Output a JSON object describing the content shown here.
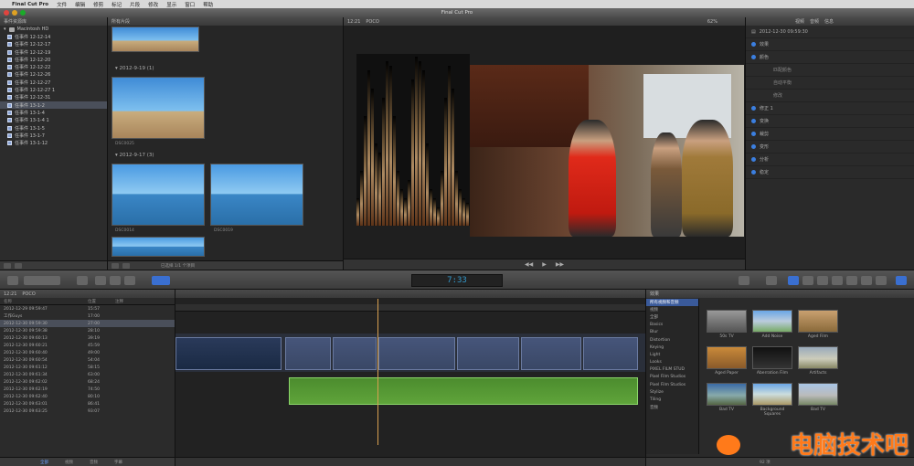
{
  "menubar": {
    "items": [
      "Final Cut Pro",
      "文件",
      "编辑",
      "修剪",
      "标记",
      "片段",
      "修改",
      "显示",
      "窗口",
      "帮助"
    ]
  },
  "window": {
    "title": "Final Cut Pro"
  },
  "library": {
    "header": "事件资源库",
    "disk": "Macintosh HD",
    "events": [
      "任事件 12-12-14",
      "任事件 12-12-17",
      "任事件 12-12-19",
      "任事件 12-12-20",
      "任事件 12-12-22",
      "任事件 12-12-26",
      "任事件 12-12-27",
      "任事件 12-12-27 1",
      "任事件 12-12-31",
      "任事件 13-1-2",
      "任事件 13-1-4",
      "任事件 13-1-4 1",
      "任事件 13-1-5",
      "任事件 13-1-7",
      "任事件 13-1-12"
    ],
    "selected_index": 9
  },
  "browser": {
    "header": "所有片段",
    "groups": [
      {
        "date": "2012-9-19",
        "count": "(1)"
      },
      {
        "date": "2012-9-17",
        "count": "(3)"
      }
    ],
    "clip_labels": [
      "DSC0025",
      "DSC0014",
      "DSC0019"
    ],
    "footer_text": "已选择 1/1 个项目"
  },
  "viewer": {
    "header_time": "12:21",
    "header_name": "POCO",
    "zoom": "62%"
  },
  "inspector": {
    "header_tabs": [
      "视频",
      "音频",
      "信息"
    ],
    "timestamp": "2012-12-30 09:59:30",
    "rows": [
      "效果",
      "颜色",
      "修正 1",
      "变换",
      "裁剪",
      "变形",
      "分析",
      "稳定"
    ],
    "sub_rows": [
      "匹配颜色",
      "自动平衡",
      "修改"
    ]
  },
  "toolbar": {
    "timecode": "7:33"
  },
  "timeline_index": {
    "header_time": "12:21",
    "header_name": "POCO",
    "col_name": "名称",
    "col_time": "位置",
    "col_note": "注释",
    "rows": [
      {
        "name": "2012-12-29 09:59:47",
        "time": "15:57"
      },
      {
        "name": "工作Guys",
        "time": "17:00"
      },
      {
        "name": "2012-12-30 09:59:30",
        "time": "27:00"
      },
      {
        "name": "2012-12-30 09:59:38",
        "time": "28:10"
      },
      {
        "name": "2012-12-30 09:60:13",
        "time": "39:19"
      },
      {
        "name": "2012-12-30 09:60:21",
        "time": "45:59"
      },
      {
        "name": "2012-12-30 09:60:40",
        "time": "49:00"
      },
      {
        "name": "2012-12-30 09:60:54",
        "time": "54:04"
      },
      {
        "name": "2012-12-30 09:61:12",
        "time": "58:15"
      },
      {
        "name": "2012-12-30 09:61:34",
        "time": "63:00"
      },
      {
        "name": "2012-12-30 09:62:02",
        "time": "68:24"
      },
      {
        "name": "2012-12-30 09:62:19",
        "time": "74:50"
      },
      {
        "name": "2012-12-30 09:62:40",
        "time": "80:10"
      },
      {
        "name": "2012-12-30 09:63:01",
        "time": "86:41"
      },
      {
        "name": "2012-12-30 09:63:25",
        "time": "93:07"
      }
    ],
    "selected_index": 2,
    "footer_tabs": [
      "全部",
      "视频",
      "音频",
      "字幕"
    ]
  },
  "effects": {
    "header": "效果",
    "categories_header": "所有视频和音频",
    "categories": [
      "视频",
      "全部",
      "Basics",
      "Blur",
      "Distortion",
      "Keying",
      "Light",
      "Looks",
      "PIXEL FILM STUD",
      "Pixel Film Studios",
      "Pixel Film Studios",
      "Stylize",
      "Tiling",
      "音频"
    ],
    "selected_category": 0,
    "items": [
      "50s TV",
      "Add Noise",
      "Aged Film",
      "Aged Paper",
      "Aberration Film",
      "Artifacts",
      "Bad TV",
      "Background Squares",
      "Bad TV"
    ],
    "footer": "92 项"
  },
  "watermark": "电脑技术吧"
}
